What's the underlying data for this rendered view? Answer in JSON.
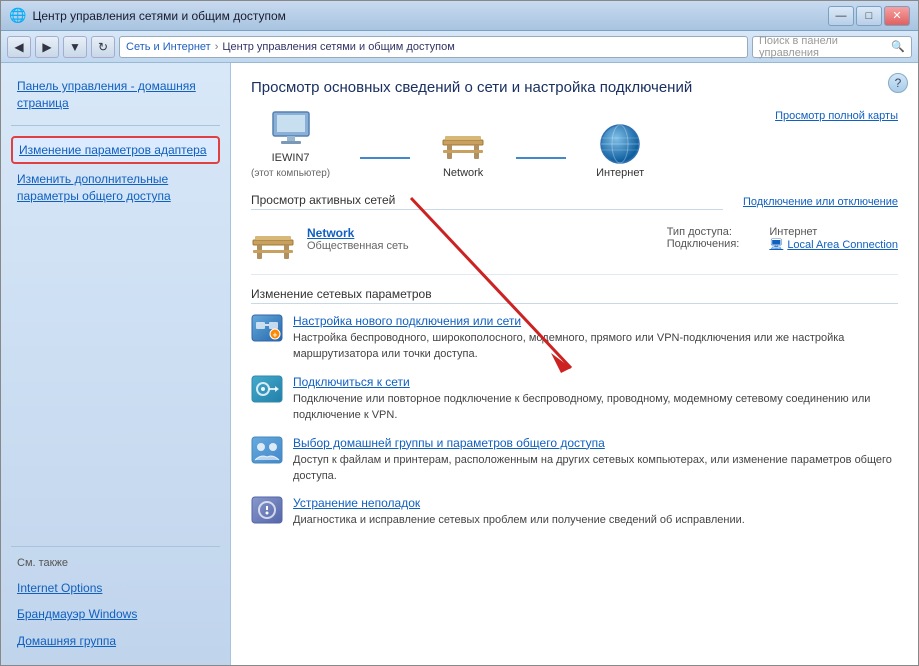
{
  "window": {
    "title": "Центр управления сетями и общим доступом"
  },
  "titlebar": {
    "title": "Центр управления сетями и общим доступом",
    "min_label": "—",
    "max_label": "□",
    "close_label": "✕"
  },
  "addressbar": {
    "back_label": "◀",
    "forward_label": "▶",
    "dropdown_label": "▼",
    "refresh_label": "↻",
    "breadcrumb": {
      "root": "Сеть и Интернет",
      "sep": "›",
      "current": "Центр управления сетями и общим доступом"
    },
    "search_placeholder": "Поиск в панели управления"
  },
  "sidebar": {
    "home_label": "Панель управления - домашняя страница",
    "adapter_label": "Изменение параметров адаптера",
    "advanced_label": "Изменить дополнительные параметры общего доступа",
    "also_label": "См. также",
    "links": [
      {
        "id": "internet-options",
        "label": "Internet Options"
      },
      {
        "id": "firewall",
        "label": "Брандмауэр Windows"
      },
      {
        "id": "homegroup",
        "label": "Домашняя группа"
      }
    ]
  },
  "content": {
    "title": "Просмотр основных сведений о сети и настройка подключений",
    "map": {
      "view_full": "Просмотр полной карты",
      "nodes": [
        {
          "id": "computer",
          "label": "IEWIN7",
          "sublabel": "(этот компьютер)"
        },
        {
          "id": "network",
          "label": "Network",
          "sublabel": ""
        },
        {
          "id": "internet",
          "label": "Интернет",
          "sublabel": ""
        }
      ]
    },
    "active_networks": {
      "title": "Просмотр активных сетей",
      "action": "Подключение или отключение",
      "network": {
        "name": "Network",
        "type": "Общественная сеть",
        "access_type_label": "Тип доступа:",
        "access_type_value": "Интернет",
        "connections_label": "Подключения:",
        "connections_value": "Local Area Connection"
      }
    },
    "change_settings": {
      "title": "Изменение сетевых параметров",
      "items": [
        {
          "id": "new-connection",
          "link": "Настройка нового подключения или сети",
          "desc": "Настройка беспроводного, широкополосного, модемного, прямого или VPN-подключения или же настройка маршрутизатора или точки доступа."
        },
        {
          "id": "connect-to",
          "link": "Подключиться к сети",
          "desc": "Подключение или повторное подключение к беспроводному, проводному, модемному сетевому соединению или подключение к VPN."
        },
        {
          "id": "homegroup-sharing",
          "link": "Выбор домашней группы и параметров общего доступа",
          "desc": "Доступ к файлам и принтерам, расположенным на других сетевых компьютерах, или изменение параметров общего доступа."
        },
        {
          "id": "troubleshoot",
          "link": "Устранение неполадок",
          "desc": "Диагностика и исправление сетевых проблем или получение сведений об исправлении."
        }
      ]
    }
  },
  "colors": {
    "link": "#1060c0",
    "bg_sidebar": "#d0e4f4",
    "bg_content": "#ffffff",
    "border": "#a8c4dc",
    "active_border": "#e04040"
  }
}
